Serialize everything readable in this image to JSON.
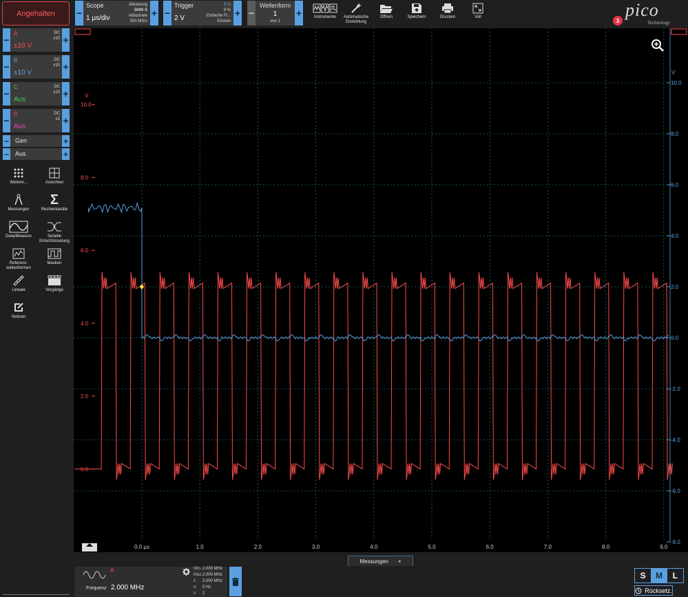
{
  "toolbar": {
    "stop_label": "Angehalten",
    "scope": {
      "title": "Scope",
      "timebase": "1 µs/div",
      "sampling_label": "Abtastung",
      "samples": "5000 S",
      "rate_label": "Abtastrate",
      "rate": "500 MS/s"
    },
    "trigger": {
      "title": "Trigger",
      "level": "2 V",
      "source": "B",
      "percent": "9 %",
      "mode": "Einfache Fl...",
      "type": "Einzeln"
    },
    "waveform": {
      "title": "Wellenform",
      "current": "1",
      "of": "von 1"
    },
    "buttons": [
      {
        "label": "Instrumente",
        "icon": "instruments-icon"
      },
      {
        "label": "Automatische Einrichtung",
        "icon": "magic-wand-icon"
      },
      {
        "label": "Öffnen",
        "icon": "folder-open-icon"
      },
      {
        "label": "Speichern",
        "icon": "save-icon"
      },
      {
        "label": "Drucken",
        "icon": "printer-icon"
      },
      {
        "label": "Voll",
        "icon": "fullscreen-icon"
      }
    ],
    "logo": "pico",
    "logo_sub": "Technology",
    "notifications": "3"
  },
  "channels": [
    {
      "name": "A",
      "coupling": "DC",
      "probe": "x10",
      "range": "±10 V",
      "color": "#ff4d4d",
      "range_color": "#ff4d4d"
    },
    {
      "name": "B",
      "coupling": "DC",
      "probe": "x10",
      "range": "±10 V",
      "color": "#5aa0e0",
      "range_color": "#5aa0e0"
    },
    {
      "name": "C",
      "coupling": "DC",
      "probe": "x10",
      "range": "Aus",
      "color": "#3ecf5a",
      "range_color": "#3ecf5a"
    },
    {
      "name": "D",
      "coupling": "DC",
      "probe": "x1",
      "range": "Aus",
      "color": "#e04cb8",
      "range_color": "#e04cb8"
    }
  ],
  "generator": {
    "label": "Gen",
    "state": "Aus"
  },
  "tools": [
    {
      "label": "Weitere...",
      "icon": "more-dots-icon"
    },
    {
      "label": "Ansichten",
      "icon": "views-grid-icon"
    },
    {
      "label": "Messungen",
      "icon": "measurements-icon"
    },
    {
      "label": "Rechenkanäle",
      "icon": "sigma-icon"
    },
    {
      "label": "DeepMeasure",
      "icon": "deepmeasure-icon"
    },
    {
      "label": "Serielle Entschlüsselung",
      "icon": "serial-decode-icon"
    },
    {
      "label": "Referenz-wellenformen",
      "icon": "reference-waveform-icon"
    },
    {
      "label": "Masken",
      "icon": "mask-icon"
    },
    {
      "label": "Lineale",
      "icon": "ruler-icon"
    },
    {
      "label": "Vorgänge",
      "icon": "clapper-icon"
    },
    {
      "label": "Notizen",
      "icon": "notes-icon"
    }
  ],
  "chart_data": {
    "type": "line",
    "title": "",
    "xlabel": "µs",
    "x_ticks": [
      "0.0 µs",
      "1.0",
      "2.0",
      "3.0",
      "4.0",
      "5.0",
      "6.0",
      "7.0",
      "8.0",
      "9.0"
    ],
    "xlim": [
      -1.18,
      9.07
    ],
    "left_axis": {
      "unit": "V",
      "ticks": [
        "10.0",
        "8.0",
        "6.0",
        "4.0",
        "2.0",
        "0.0"
      ],
      "ylim": [
        -2.0,
        12.0
      ],
      "color": "#ff4d4d"
    },
    "right_axis": {
      "unit": "V",
      "ticks": [
        "10.0",
        "8.0",
        "6.0",
        "4.0",
        "2.0",
        "0.0",
        "-2.0",
        "-4.0",
        "-6.0",
        "-8.0"
      ],
      "ylim": [
        -8.0,
        12.0
      ],
      "color": "#5aa0e0"
    },
    "grid": true,
    "trigger_point": {
      "x": 0.0,
      "y": 2.0
    },
    "series": [
      {
        "name": "A",
        "color": "#ff4d4d",
        "shape": "square",
        "frequency_mhz": 2.0,
        "low": 0.0,
        "high": 5.1,
        "first_rise": -0.7
      },
      {
        "name": "B",
        "color": "#5aa0e0",
        "shape": "step",
        "before": 5.1,
        "after": 0.0,
        "step_at": 0.0
      }
    ]
  },
  "zoom_icon": "zoom-in-icon",
  "measurements": {
    "tab_label": "Messungen",
    "tab_close": "×",
    "channel": "A",
    "label": "Frequenz",
    "value": "2.000 MHz",
    "stats": [
      {
        "k": "Min.",
        "v": "2.000 MHz"
      },
      {
        "k": "Max.",
        "v": "2.000 MHz"
      },
      {
        "k": "x̄",
        "v": "2.000 MHz"
      },
      {
        "k": "σ",
        "v": "0 Hz"
      },
      {
        "k": "n",
        "v": "2"
      }
    ]
  },
  "size_toggle": {
    "options": [
      "S",
      "M",
      "L"
    ],
    "selected": "M"
  },
  "reset_label": "Rücksetz."
}
